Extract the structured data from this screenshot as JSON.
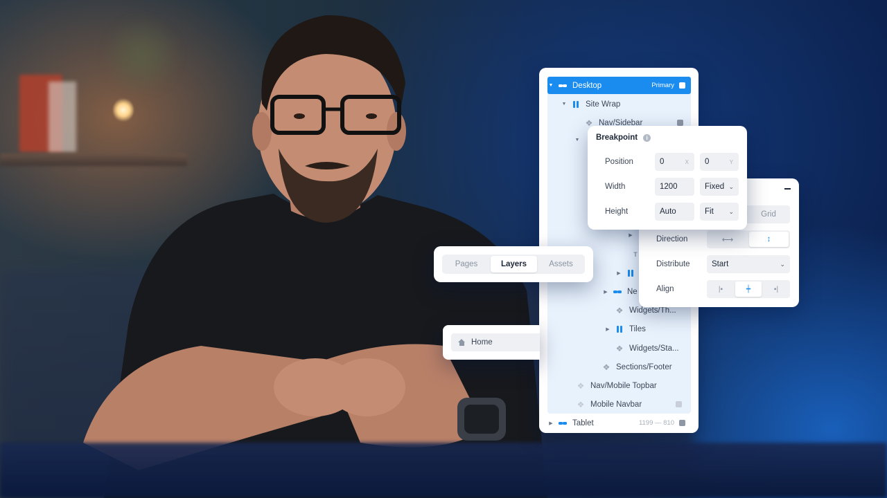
{
  "layers": {
    "items": [
      {
        "label": "Desktop",
        "tag": "Primary"
      },
      {
        "label": "Site Wrap"
      },
      {
        "label": "Nav/Sidebar"
      },
      {
        "label": "Ne"
      },
      {
        "label": "Widgets/Th..."
      },
      {
        "label": "Tiles"
      },
      {
        "label": "Widgets/Sta..."
      },
      {
        "label": "Sections/Footer"
      },
      {
        "label": "Nav/Mobile Topbar"
      },
      {
        "label": "Mobile Navbar"
      },
      {
        "label": "Tablet",
        "tag": "1199 — 810"
      }
    ]
  },
  "breakpoint": {
    "title": "Breakpoint",
    "position_label": "Position",
    "position_x": "0",
    "position_x_axis": "X",
    "position_y": "0",
    "position_y_axis": "Y",
    "width_label": "Width",
    "width_value": "1200",
    "width_mode": "Fixed",
    "height_label": "Height",
    "height_value": "Auto",
    "height_mode": "Fit"
  },
  "layout": {
    "grid_label": "Grid",
    "direction_label": "Direction",
    "distribute_label": "Distribute",
    "distribute_value": "Start",
    "align_label": "Align"
  },
  "tabs": {
    "items": [
      "Pages",
      "Layers",
      "Assets"
    ],
    "active": "Layers"
  },
  "home": {
    "label": "Home"
  },
  "colors": {
    "accent": "#1a8cf0",
    "tree_background": "#e8f2fd"
  }
}
